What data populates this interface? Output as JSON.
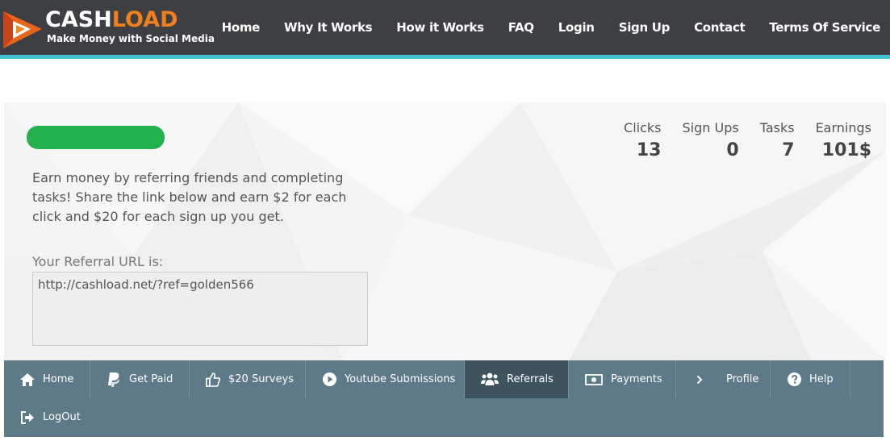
{
  "header": {
    "logo": {
      "title_a": "CASH",
      "title_b": "LOAD",
      "tagline": "Make Money with Social Media"
    },
    "nav": [
      {
        "label": "Home"
      },
      {
        "label": "Why It Works"
      },
      {
        "label": "How it Works"
      },
      {
        "label": "FAQ"
      },
      {
        "label": "Login"
      },
      {
        "label": "Sign Up"
      },
      {
        "label": "Contact"
      },
      {
        "label": "Terms Of Service"
      }
    ],
    "colors": {
      "bar": "#3d3f42",
      "accent_line": "#3fc3d8",
      "logo_orange": "#f07f1e"
    }
  },
  "hero": {
    "description": "Earn money by referring friends and completing tasks! Share the link below and earn $2 for each click and $20 for each sign up you get.",
    "referral_label": "Your Referral URL is:",
    "referral_url": "http://cashload.net/?ref=golden566",
    "stats": [
      {
        "label": "Clicks",
        "value": "13"
      },
      {
        "label": "Sign Ups",
        "value": "0"
      },
      {
        "label": "Tasks",
        "value": "7"
      },
      {
        "label": "Earnings",
        "value": "101$"
      }
    ],
    "colors": {
      "redaction": "#22b14c"
    }
  },
  "dashboard_menu": {
    "items": [
      {
        "label": "Home",
        "icon": "home-icon",
        "active": false
      },
      {
        "label": "Get Paid",
        "icon": "paypal-icon",
        "active": false
      },
      {
        "label": "$20 Surveys",
        "icon": "thumbs-up-icon",
        "active": false
      },
      {
        "label": "Youtube Submissions",
        "icon": "play-circle-icon",
        "active": false
      },
      {
        "label": "Referrals",
        "icon": "users-icon",
        "active": true
      },
      {
        "label": "Payments",
        "icon": "money-icon",
        "active": false
      },
      {
        "label": "Profile",
        "icon": "chevron-right-icon",
        "active": false
      },
      {
        "label": "Help",
        "icon": "question-circle-icon",
        "active": false
      },
      {
        "label": "LogOut",
        "icon": "sign-out-icon",
        "active": false
      }
    ],
    "colors": {
      "bar": "#5e7a89",
      "active": "#3e5360"
    }
  }
}
